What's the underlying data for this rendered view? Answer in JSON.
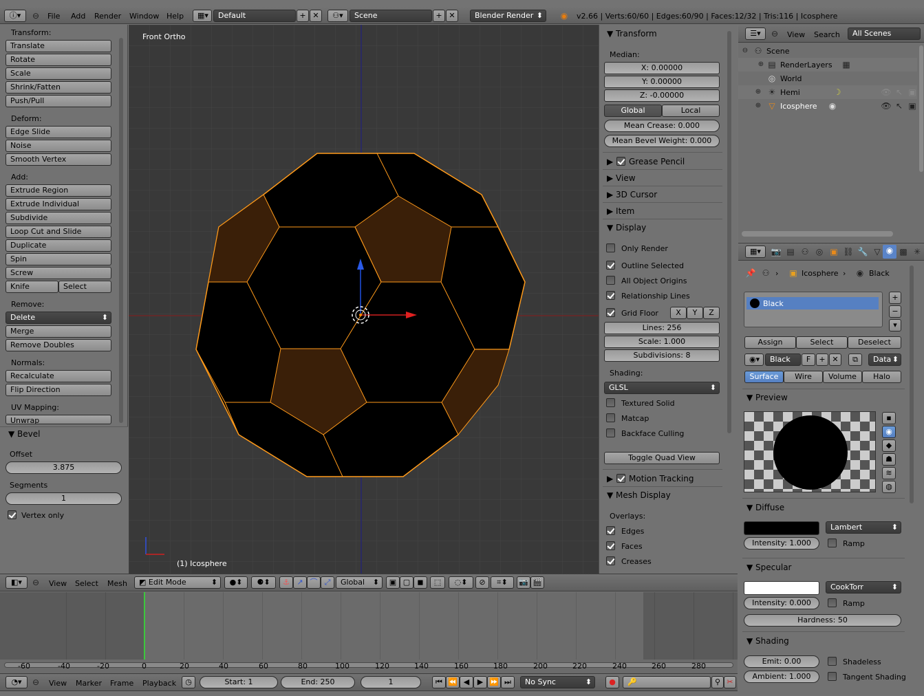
{
  "topbar": {
    "menus": [
      "File",
      "Add",
      "Render",
      "Window",
      "Help"
    ],
    "layout": "Default",
    "scene": "Scene",
    "engine": "Blender Render",
    "stats": "v2.66 | Verts:60/60 | Edges:60/90 | Faces:12/32 | Tris:116 | Icosphere"
  },
  "toolshelf": {
    "transform_title": "Transform:",
    "transform": [
      "Translate",
      "Rotate",
      "Scale",
      "Shrink/Fatten",
      "Push/Pull"
    ],
    "deform_title": "Deform:",
    "deform": [
      "Edge Slide",
      "Noise",
      "Smooth Vertex"
    ],
    "add_title": "Add:",
    "add": [
      "Extrude Region",
      "Extrude Individual",
      "Subdivide",
      "Loop Cut and Slide",
      "Duplicate",
      "Spin",
      "Screw"
    ],
    "knife": "Knife",
    "select": "Select",
    "remove_title": "Remove:",
    "delete": "Delete",
    "remove": [
      "Merge",
      "Remove Doubles"
    ],
    "normals_title": "Normals:",
    "normals": [
      "Recalculate",
      "Flip Direction"
    ],
    "uv_title": "UV Mapping:",
    "unwrap": "Unwrap"
  },
  "operator": {
    "title": "Bevel",
    "offset_label": "Offset",
    "offset": "3.875",
    "segments_label": "Segments",
    "segments": "1",
    "vertex_only": "Vertex only"
  },
  "viewport": {
    "view_name": "Front Ortho",
    "object_label": "(1) Icosphere"
  },
  "nprops": {
    "transform": "Transform",
    "median": "Median:",
    "x": "X: 0.00000",
    "y": "Y: 0.00000",
    "z": "Z: -0.00000",
    "global": "Global",
    "local": "Local",
    "crease": "Mean Crease: 0.000",
    "bevel": "Mean Bevel Weight: 0.000",
    "grease": "Grease Pencil",
    "view": "View",
    "cursor": "3D Cursor",
    "item": "Item",
    "display": "Display",
    "only_render": "Only Render",
    "outline": "Outline Selected",
    "origins": "All Object Origins",
    "relations": "Relationship Lines",
    "grid_floor": "Grid Floor",
    "gx": "X",
    "gy": "Y",
    "gz": "Z",
    "lines": "Lines: 256",
    "scale": "Scale: 1.000",
    "subdiv": "Subdivisions: 8",
    "shading": "Shading:",
    "glsl": "GLSL",
    "textured": "Textured Solid",
    "matcap": "Matcap",
    "backface": "Backface Culling",
    "quad": "Toggle Quad View",
    "motion": "Motion Tracking",
    "mesh_display": "Mesh Display",
    "overlays": "Overlays:",
    "edges": "Edges",
    "faces": "Faces",
    "creases": "Creases"
  },
  "view3d_header": {
    "menus": [
      "View",
      "Select",
      "Mesh"
    ],
    "mode": "Edit Mode",
    "orientation": "Global"
  },
  "outliner": {
    "menus": [
      "View",
      "Search"
    ],
    "filter": "All Scenes",
    "items": [
      "Scene",
      "RenderLayers",
      "World",
      "Hemi",
      "Icosphere"
    ]
  },
  "properties": {
    "breadcrumb_obj": "Icosphere",
    "breadcrumb_mat": "Black",
    "slot": "Black",
    "assign": "Assign",
    "select": "Select",
    "deselect": "Deselect",
    "mat_name": "Black",
    "f": "F",
    "data": "Data",
    "tabs": [
      "Surface",
      "Wire",
      "Volume",
      "Halo"
    ],
    "preview": "Preview",
    "diffuse": "Diffuse",
    "diffuse_shader": "Lambert",
    "diffuse_int": "Intensity: 1.000",
    "ramp": "Ramp",
    "specular": "Specular",
    "spec_shader": "CookTorr",
    "spec_int": "Intensity: 0.000",
    "ramp2": "Ramp",
    "hardness": "Hardness: 50",
    "shading": "Shading",
    "emit": "Emit: 0.00",
    "shadeless": "Shadeless",
    "ambient": "Ambient: 1.000",
    "tangent": "Tangent Shading",
    "diffuse_color": "#000000",
    "spec_color": "#ffffff"
  },
  "timeline": {
    "ticks": [
      "-60",
      "-40",
      "-20",
      "0",
      "20",
      "40",
      "60",
      "80",
      "100",
      "120",
      "140",
      "160",
      "180",
      "200",
      "220",
      "240",
      "260",
      "280"
    ],
    "menus": [
      "View",
      "Marker",
      "Frame",
      "Playback"
    ],
    "start": "Start: 1",
    "end": "End: 250",
    "frame": "1",
    "sync": "No Sync"
  },
  "colors": {
    "face_selected": "#3a1f08",
    "edge_selected": "#ff9a1a",
    "viewport_bg": "#393939"
  }
}
